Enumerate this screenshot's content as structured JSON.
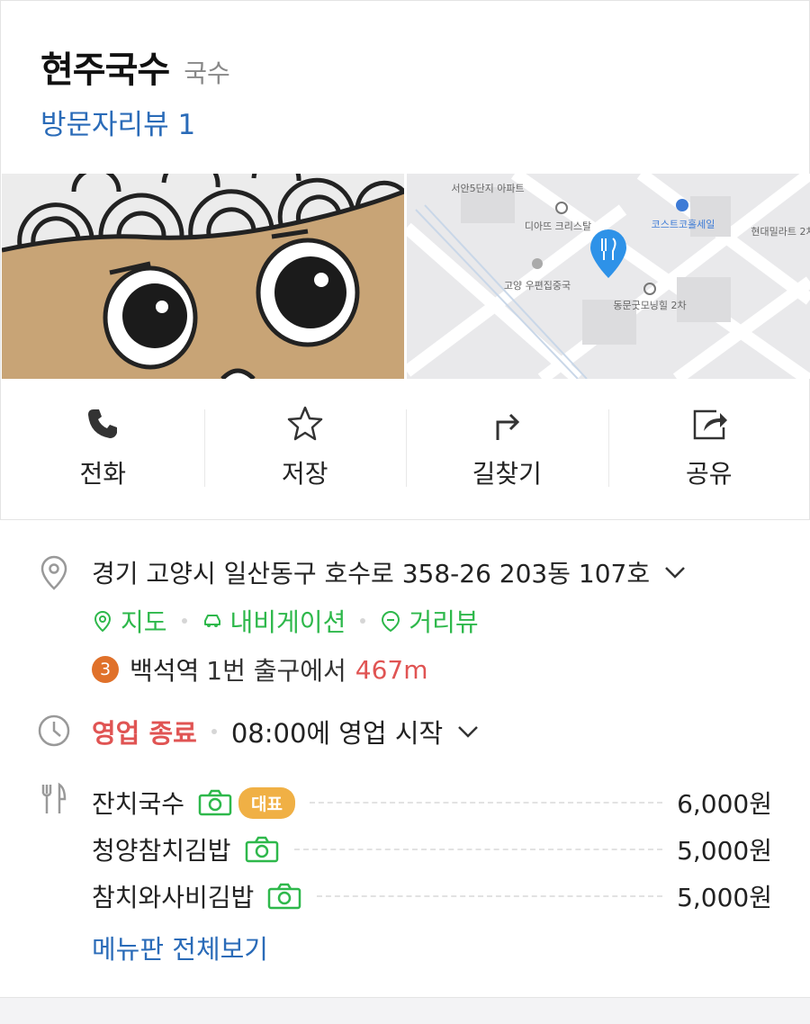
{
  "place": {
    "name": "현주국수",
    "category": "국수",
    "review": "방문자리뷰 1"
  },
  "map": {
    "labels": [
      "서안5단지 아파트",
      "디아뜨 크리스탈",
      "코스트코홀세일",
      "현대밀라트 2차",
      "고양 우편집중국",
      "동문굿모닝힐 2차"
    ]
  },
  "actions": [
    {
      "label": "전화",
      "icon": "phone-icon"
    },
    {
      "label": "저장",
      "icon": "star-icon"
    },
    {
      "label": "길찾기",
      "icon": "directions-icon"
    },
    {
      "label": "공유",
      "icon": "share-icon"
    }
  ],
  "info": {
    "address": "경기 고양시 일산동구 호수로 358-26 203동 107호",
    "links": {
      "map": "지도",
      "navigation": "내비게이션",
      "street_view": "거리뷰"
    },
    "station": {
      "line": "3",
      "name": "백석역",
      "exit": "1번 출구에서",
      "distance": "467m"
    },
    "hours": {
      "status": "영업 종료",
      "next_open": "08:00에 영업 시작"
    },
    "menu": [
      {
        "name": "잔치국수",
        "badge": "대표",
        "price": "6,000원"
      },
      {
        "name": "청양참치김밥",
        "price": "5,000원"
      },
      {
        "name": "참치와사비김밥",
        "price": "5,000원"
      }
    ],
    "menu_all": "메뉴판 전체보기"
  },
  "colors": {
    "link_blue": "#2a6bb8",
    "green": "#2eb84b",
    "closed_red": "#e05453",
    "badge_orange": "#f0b045",
    "line3_orange": "#e0712a"
  }
}
